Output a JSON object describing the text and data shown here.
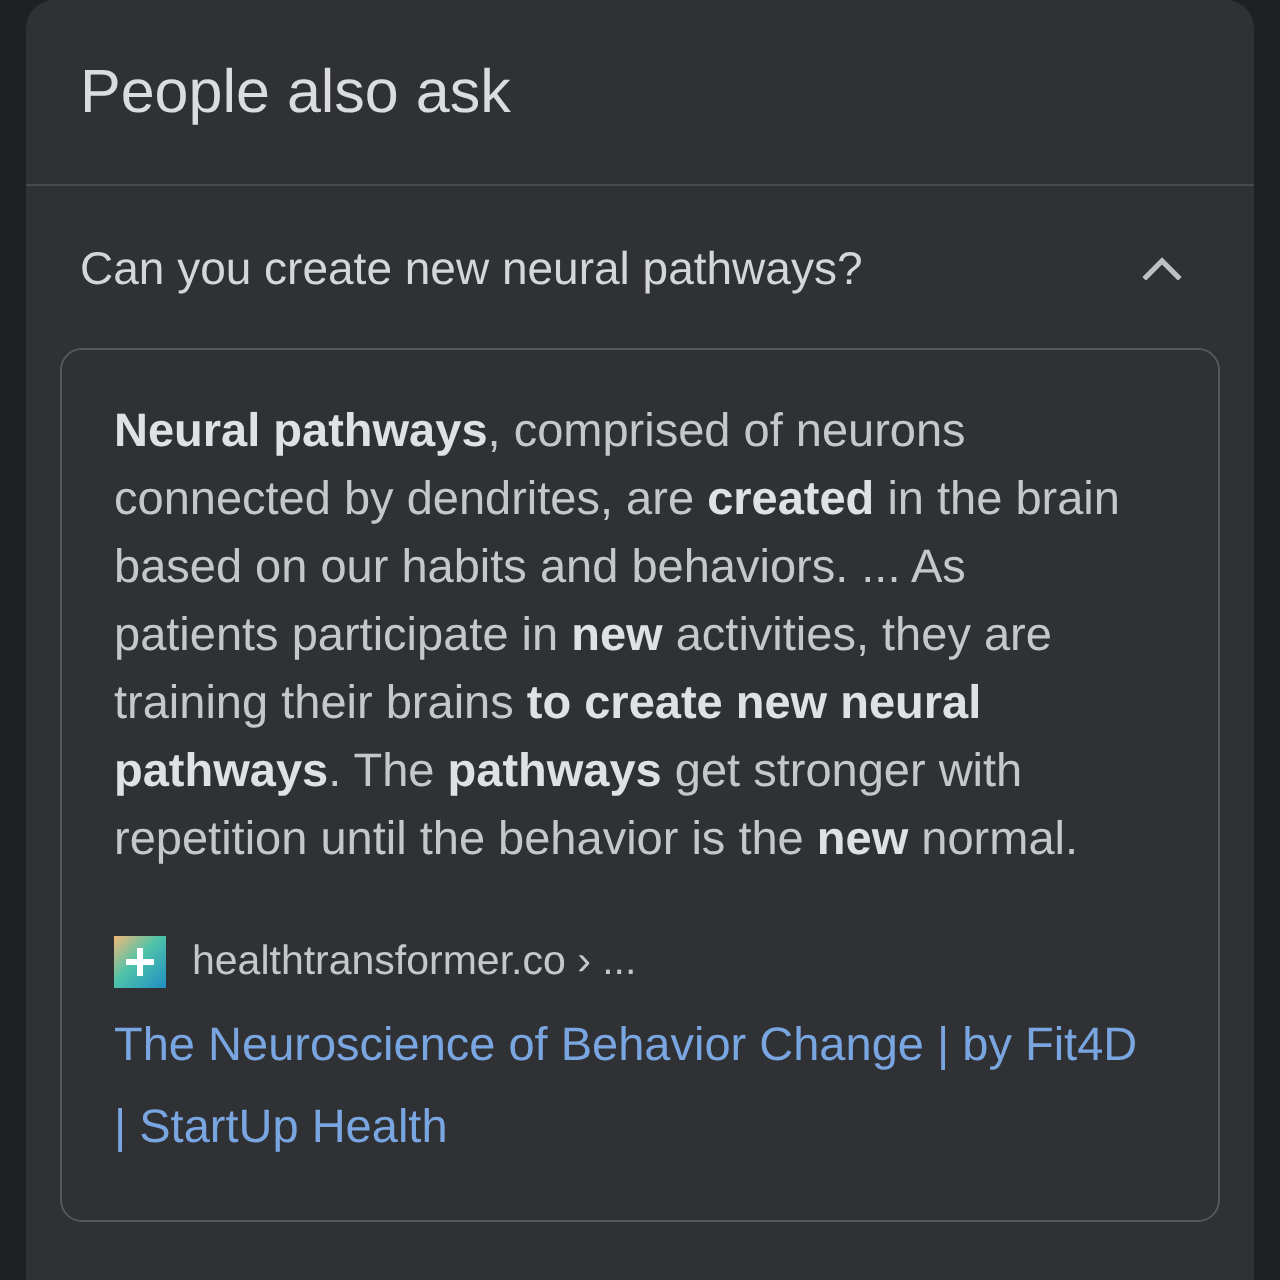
{
  "section": {
    "title": "People also ask"
  },
  "question": {
    "text": "Can you create new neural pathways?",
    "expanded": true
  },
  "answer": {
    "snippet": "**Neural pathways**, comprised of neurons connected by dendrites, are **created** in the brain based on our habits and behaviors. ... As patients participate in **new** activities, they are training their brains **to create new neural pathways**. The **pathways** get stronger with repetition until the behavior is the **new** normal.",
    "source": {
      "site": "healthtransformer.co › ...",
      "link": "The Neuroscience of Behavior Change | by Fit4D | StartUp Health"
    }
  }
}
